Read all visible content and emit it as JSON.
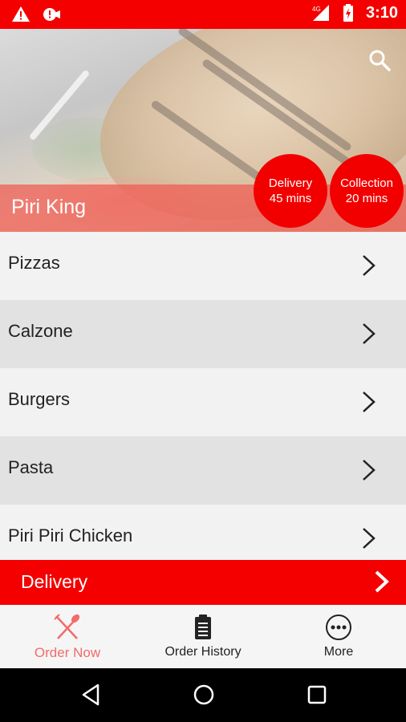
{
  "status_bar": {
    "time": "3:10",
    "network": "4G",
    "icons": [
      "warning-icon",
      "alert-badge-icon",
      "signal-icon",
      "battery-charging-icon"
    ]
  },
  "hero": {
    "restaurant_name": "Piri King",
    "search_icon": "search-icon",
    "delivery_badge": {
      "line1": "Delivery",
      "line2": "45 mins"
    },
    "collection_badge": {
      "line1": "Collection",
      "line2": "20 mins"
    }
  },
  "menu": {
    "items": [
      {
        "label": "Pizzas"
      },
      {
        "label": "Calzone"
      },
      {
        "label": "Burgers"
      },
      {
        "label": "Pasta"
      },
      {
        "label": "Piri Piri Chicken"
      }
    ]
  },
  "delivery_bar": {
    "label": "Delivery"
  },
  "bottom_nav": {
    "items": [
      {
        "label": "Order Now",
        "icon": "fork-knife-icon",
        "active": true
      },
      {
        "label": "Order History",
        "icon": "clipboard-icon",
        "active": false
      },
      {
        "label": "More",
        "icon": "more-dots-icon",
        "active": false
      }
    ]
  },
  "colors": {
    "primary_red": "#f40000",
    "active_nav": "#f26b6b"
  }
}
